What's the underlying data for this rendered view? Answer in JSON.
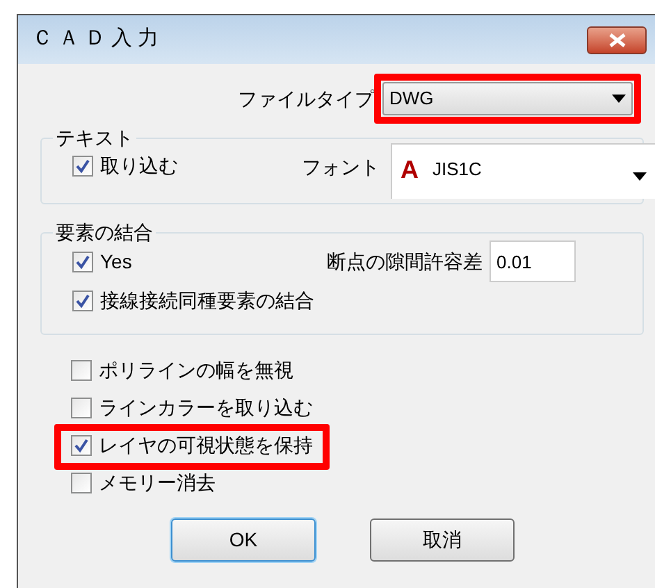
{
  "window": {
    "title": "ＣＡＤ入力"
  },
  "file_type": {
    "label": "ファイルタイプ",
    "value": "DWG",
    "highlighted": true
  },
  "text_group": {
    "title": "テキスト",
    "import": {
      "label": "取り込む",
      "checked": true
    },
    "font_label": "フォント",
    "font_icon": "A",
    "font_value": "JIS1C"
  },
  "merge_group": {
    "title": "要素の結合",
    "yes": {
      "label": "Yes",
      "checked": true
    },
    "tolerance_label": "断点の隙間許容差",
    "tolerance_value": "0.01",
    "tangent": {
      "label": "接線接続同種要素の結合",
      "checked": true
    }
  },
  "options": [
    {
      "label": "ポリラインの幅を無視",
      "checked": false,
      "highlighted": false
    },
    {
      "label": "ラインカラーを取り込む",
      "checked": false,
      "highlighted": false
    },
    {
      "label": "レイヤの可視状態を保持",
      "checked": true,
      "highlighted": true
    },
    {
      "label": "メモリー消去",
      "checked": false,
      "highlighted": false
    }
  ],
  "buttons": [
    {
      "label": "OK",
      "kind": "default"
    },
    {
      "label": "取消",
      "kind": "normal"
    }
  ]
}
